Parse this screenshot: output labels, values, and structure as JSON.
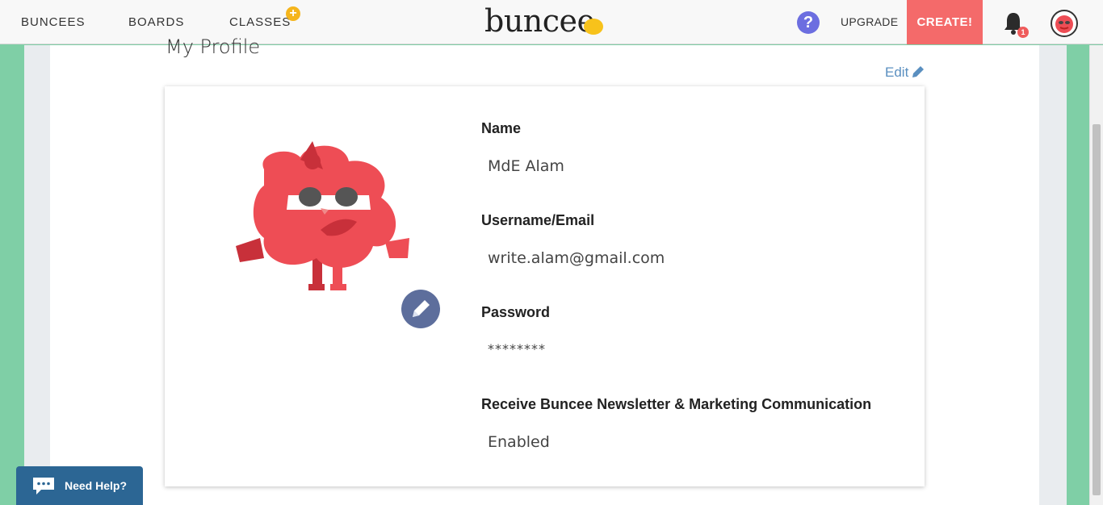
{
  "header": {
    "nav": [
      "BUNCEES",
      "BOARDS",
      "CLASSES"
    ],
    "logo": "buncee",
    "help_glyph": "?",
    "upgrade": "UPGRADE",
    "create": "CREATE!",
    "notifications_count": "1"
  },
  "profile": {
    "title": "My Profile",
    "edit": "Edit",
    "fields": {
      "name_label": "Name",
      "name_value": "MdE Alam",
      "username_label": "Username/Email",
      "username_value": "write.alam@gmail.com",
      "password_label": "Password",
      "password_value": "********",
      "newsletter_label": "Receive Buncee Newsletter & Marketing Communication",
      "newsletter_value": "Enabled"
    }
  },
  "help_widget": {
    "label": "Need Help?"
  },
  "colors": {
    "background_green": "#7fcfa6",
    "create_button": "#f46a6a",
    "accent_blue": "#5a8fc0",
    "help_widget": "#2c6694",
    "avatar_edit": "#5d6e9c",
    "monster_red": "#ee4d55"
  },
  "icons": [
    "plus-icon",
    "help-icon",
    "bell-icon",
    "avatar-icon",
    "pencil-icon",
    "chat-icon"
  ]
}
